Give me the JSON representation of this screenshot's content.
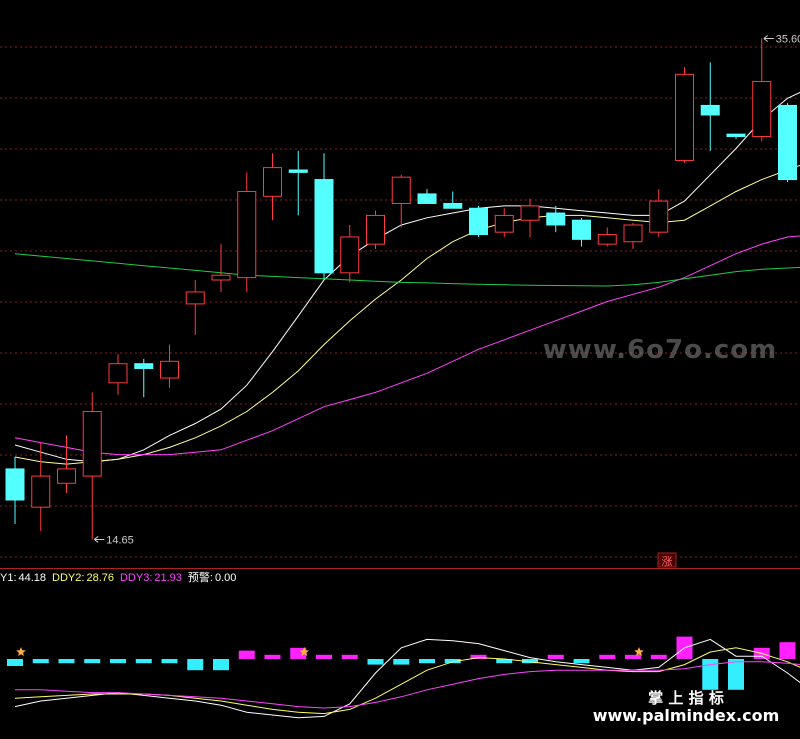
{
  "chart_data": [
    {
      "type": "candlestick",
      "title": "",
      "grid": true,
      "ylim": [
        14.0,
        37.0
      ],
      "annotations": {
        "high": "35.60",
        "low": "14.65",
        "zhang_marker": "涨"
      },
      "candles": [
        {
          "o": 17.6,
          "h": 18.1,
          "l": 15.3,
          "c": 16.3
        },
        {
          "o": 16.0,
          "h": 18.7,
          "l": 15.0,
          "c": 17.3
        },
        {
          "o": 17.0,
          "h": 19.0,
          "l": 16.6,
          "c": 17.6
        },
        {
          "o": 17.3,
          "h": 20.8,
          "l": 14.65,
          "c": 20.0
        },
        {
          "o": 21.2,
          "h": 22.4,
          "l": 20.7,
          "c": 22.0
        },
        {
          "o": 22.0,
          "h": 22.2,
          "l": 20.6,
          "c": 21.8
        },
        {
          "o": 21.4,
          "h": 22.8,
          "l": 21.0,
          "c": 22.1
        },
        {
          "o": 24.5,
          "h": 25.5,
          "l": 23.2,
          "c": 25.0
        },
        {
          "o": 25.5,
          "h": 27.0,
          "l": 25.0,
          "c": 25.7
        },
        {
          "o": 25.6,
          "h": 30.0,
          "l": 25.0,
          "c": 29.2
        },
        {
          "o": 29.0,
          "h": 30.8,
          "l": 28.0,
          "c": 30.2
        },
        {
          "o": 30.1,
          "h": 30.9,
          "l": 28.2,
          "c": 30.0
        },
        {
          "o": 29.7,
          "h": 30.8,
          "l": 25.5,
          "c": 25.8
        },
        {
          "o": 25.8,
          "h": 27.8,
          "l": 25.4,
          "c": 27.3
        },
        {
          "o": 27.0,
          "h": 28.4,
          "l": 26.8,
          "c": 28.2
        },
        {
          "o": 28.7,
          "h": 29.9,
          "l": 27.7,
          "c": 29.8
        },
        {
          "o": 29.1,
          "h": 29.3,
          "l": 28.8,
          "c": 28.7
        },
        {
          "o": 28.7,
          "h": 29.2,
          "l": 28.5,
          "c": 28.5
        },
        {
          "o": 28.5,
          "h": 28.6,
          "l": 27.3,
          "c": 27.4
        },
        {
          "o": 27.5,
          "h": 28.5,
          "l": 27.3,
          "c": 28.2
        },
        {
          "o": 28.0,
          "h": 28.9,
          "l": 27.3,
          "c": 28.6
        },
        {
          "o": 28.3,
          "h": 28.6,
          "l": 27.5,
          "c": 27.8
        },
        {
          "o": 28.0,
          "h": 28.1,
          "l": 26.9,
          "c": 27.2
        },
        {
          "o": 27.0,
          "h": 27.7,
          "l": 26.9,
          "c": 27.4
        },
        {
          "o": 27.1,
          "h": 27.9,
          "l": 26.8,
          "c": 27.8
        },
        {
          "o": 27.5,
          "h": 29.3,
          "l": 27.3,
          "c": 28.8
        },
        {
          "o": 30.5,
          "h": 34.4,
          "l": 30.4,
          "c": 34.1
        },
        {
          "o": 32.8,
          "h": 34.6,
          "l": 30.9,
          "c": 32.4
        },
        {
          "o": 31.6,
          "h": 31.6,
          "l": 31.4,
          "c": 31.5
        },
        {
          "o": 31.5,
          "h": 35.6,
          "l": 31.3,
          "c": 33.8
        },
        {
          "o": 32.8,
          "h": 32.9,
          "l": 29.6,
          "c": 29.7
        },
        {
          "o": 29.6,
          "h": 30.8,
          "l": 29.4,
          "c": 29.8
        }
      ],
      "series": [
        {
          "values": [
            18.6,
            18.3,
            18.0,
            17.9,
            18.0,
            18.4,
            19.0,
            19.5,
            20.1,
            21.1,
            22.5,
            24.0,
            25.5,
            26.5,
            27.2,
            27.8,
            28.1,
            28.3,
            28.5,
            28.6,
            28.6,
            28.5,
            28.4,
            28.3,
            28.2,
            28.2,
            28.8,
            29.9,
            31.0,
            32.2,
            33.1,
            33.6
          ],
          "color": "#ffffff"
        },
        {
          "values": [
            18.1,
            17.9,
            17.8,
            17.9,
            18.0,
            18.2,
            18.5,
            18.9,
            19.4,
            20.0,
            20.8,
            21.7,
            22.8,
            23.8,
            24.7,
            25.5,
            26.4,
            27.1,
            27.6,
            27.9,
            28.1,
            28.2,
            28.2,
            28.1,
            28.0,
            27.9,
            28.0,
            28.6,
            29.2,
            29.7,
            30.1,
            30.5
          ],
          "color": "#ffff99"
        },
        {
          "values": [
            18.9,
            18.7,
            18.5,
            18.3,
            18.2,
            18.2,
            18.2,
            18.3,
            18.4,
            18.8,
            19.2,
            19.7,
            20.2,
            20.5,
            20.8,
            21.2,
            21.6,
            22.1,
            22.6,
            23.0,
            23.4,
            23.8,
            24.2,
            24.6,
            24.9,
            25.2,
            25.6,
            26.1,
            26.6,
            27.0,
            27.3,
            27.4
          ],
          "color": "#ff44ff"
        },
        {
          "values": [
            26.6,
            26.5,
            26.4,
            26.3,
            26.2,
            26.1,
            26.0,
            25.9,
            25.8,
            25.7,
            25.65,
            25.6,
            25.55,
            25.5,
            25.45,
            25.4,
            25.38,
            25.35,
            25.32,
            25.3,
            25.28,
            25.27,
            25.26,
            25.25,
            25.3,
            25.4,
            25.55,
            25.7,
            25.85,
            25.95,
            26.0,
            26.05
          ],
          "color": "#22cc44"
        }
      ]
    },
    {
      "type": "indicator",
      "title": "",
      "legend": [
        {
          "name": "Y1:",
          "value": "44.18",
          "color": "#ffffff"
        },
        {
          "name": "DDY2:",
          "value": "28.76",
          "color": "#ffff66"
        },
        {
          "name": "DDY3:",
          "value": "21.93",
          "color": "#ff44ff"
        },
        {
          "name": "预警:",
          "value": "0.00",
          "color": "#ffffff"
        }
      ],
      "ylim": [
        -30,
        30
      ],
      "zero": 0,
      "bars": [
        -5,
        -3,
        -3,
        -3,
        -3,
        -3,
        -3,
        -8,
        -8,
        6,
        3,
        8,
        3,
        3,
        -4,
        -4,
        -3,
        -3,
        3,
        -3,
        -3,
        3,
        -3,
        3,
        3,
        3,
        16,
        -22,
        -22,
        8,
        12,
        -14
      ],
      "stars": [
        0,
        11,
        24
      ],
      "series": [
        {
          "values": [
            -34,
            -30,
            -28,
            -26,
            -24,
            -26,
            -28,
            -30,
            -33,
            -38,
            -40,
            -42,
            -41,
            -32,
            -10,
            8,
            14,
            13,
            11,
            6,
            1,
            -2,
            -4,
            -6,
            -8,
            -6,
            8,
            14,
            2,
            2,
            -10,
            -24
          ],
          "color": "#ffffff"
        },
        {
          "values": [
            -28,
            -27,
            -26,
            -25,
            -25,
            -25,
            -26,
            -28,
            -30,
            -33,
            -36,
            -38,
            -39,
            -36,
            -28,
            -18,
            -8,
            -2,
            1,
            0,
            -2,
            -4,
            -6,
            -8,
            -9,
            -9,
            -4,
            5,
            8,
            4,
            -2,
            -10
          ],
          "color": "#ffff66"
        },
        {
          "values": [
            -22,
            -22,
            -23,
            -24,
            -24,
            -25,
            -26,
            -27,
            -28,
            -30,
            -32,
            -34,
            -35,
            -34,
            -31,
            -27,
            -22,
            -18,
            -14,
            -11,
            -9,
            -8,
            -8,
            -8,
            -8,
            -8,
            -7,
            -4,
            -2,
            -2,
            -3,
            -5
          ],
          "color": "#ff44ff"
        }
      ]
    }
  ],
  "watermarks": {
    "center": "www.6o7o.com",
    "corner_cn": "掌 上 指 标",
    "corner_url": "www.palmindex.com"
  }
}
